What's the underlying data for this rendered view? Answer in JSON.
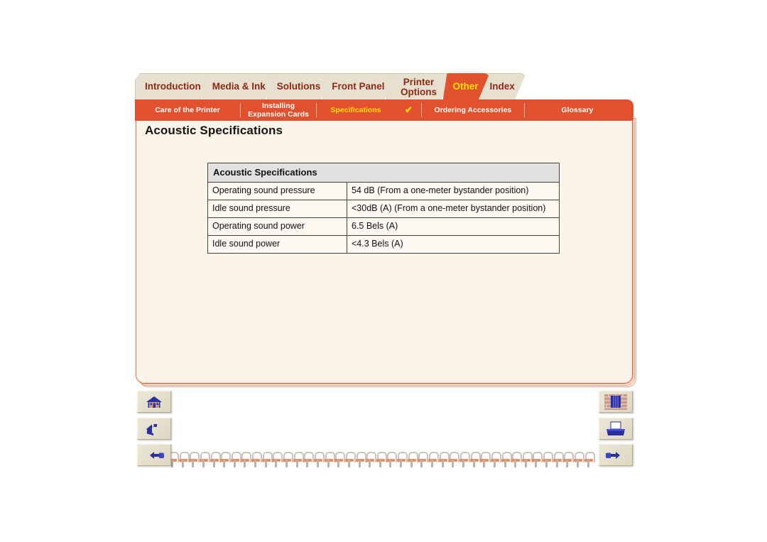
{
  "tabs": [
    {
      "label": "Introduction",
      "active": false
    },
    {
      "label": "Media & Ink",
      "active": false
    },
    {
      "label": "Solutions",
      "active": false
    },
    {
      "label": "Front Panel",
      "active": false
    },
    {
      "label": "Printer Options",
      "active": false
    },
    {
      "label": "Other",
      "active": true
    },
    {
      "label": "Index",
      "active": false
    }
  ],
  "subnav": {
    "items": [
      {
        "label": "Care of the Printer",
        "active": false,
        "check": false
      },
      {
        "label": "Installing Expansion Cards",
        "active": false,
        "check": false
      },
      {
        "label": "Specifications",
        "active": true,
        "check": true
      },
      {
        "label": "Ordering Accessories",
        "active": false,
        "check": false
      },
      {
        "label": "Glossary",
        "active": false,
        "check": false
      }
    ],
    "check_glyph": "✔"
  },
  "page": {
    "title": "Acoustic Specifications"
  },
  "table": {
    "header": "Acoustic Specifications",
    "rows": [
      {
        "label": "Operating sound pressure",
        "value": "54 dB (From a one-meter bystander position)"
      },
      {
        "label": "Idle sound pressure",
        "value": "<30dB (A) (From a one-meter bystander position)"
      },
      {
        "label": "Operating sound power",
        "value": "6.5 Bels (A)"
      },
      {
        "label": "Idle sound power",
        "value": "<4.3 Bels (A)"
      }
    ]
  },
  "nav_buttons": {
    "home": "home-icon",
    "back": "back-arrow-icon",
    "prev": "previous-page-hand-icon",
    "index": "bookshelf-index-icon",
    "print": "printer-icon",
    "next": "next-page-hand-icon"
  },
  "colors": {
    "accent_red": "#e2512e",
    "tab_beige": "#e7dfcf",
    "tab_text": "#8d2b12",
    "active_text": "#ffe000",
    "page_bg": "#fdf4e9",
    "table_header_bg": "#e2e2e2"
  },
  "spiral": {
    "ring_count": 41
  }
}
